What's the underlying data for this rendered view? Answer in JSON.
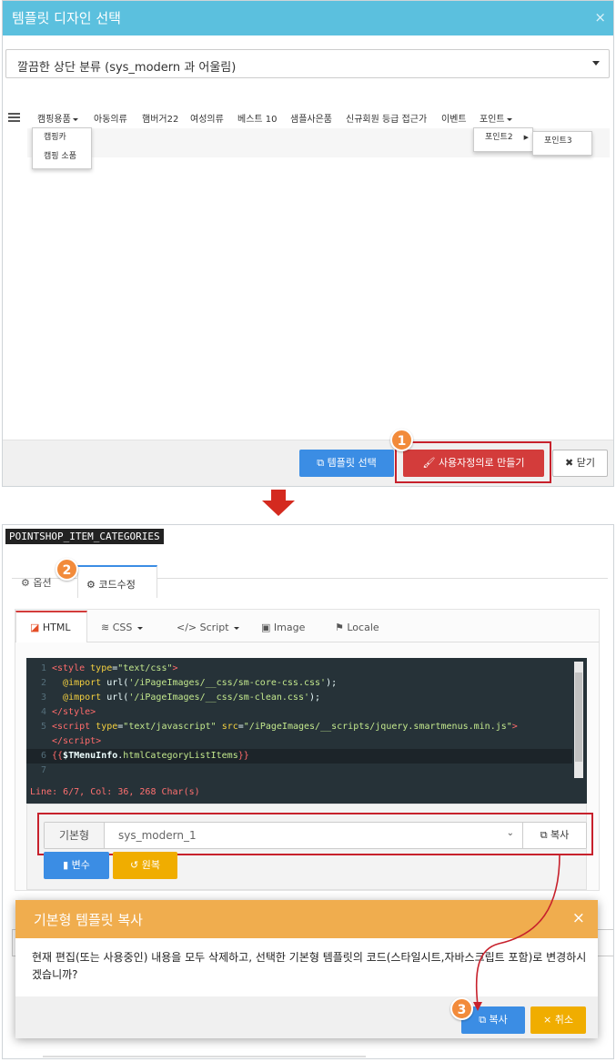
{
  "modal": {
    "title": "템플릿 디자인 선택",
    "close_icon": "×",
    "select_value": "깔끔한 상단 분류 (sys_modern 과 어울림)",
    "menu": {
      "items": [
        "캠핑용품",
        "아동의류",
        "햄버거22",
        "여성의류",
        "베스트 10",
        "샘플사은품",
        "신규회원 등급 접근가",
        "이벤트",
        "포인트"
      ],
      "submenu_camping": [
        "캠핑카",
        "캠핑 소품"
      ],
      "submenu_point": [
        "포인트2"
      ],
      "submenu_point2": [
        "포인트3"
      ]
    },
    "footer": {
      "template_select": "템플릿 선택",
      "customize": "사용자정의로 만들기",
      "close": "닫기"
    },
    "badge1": "1"
  },
  "panel": {
    "title": "POINTSHOP_ITEM_CATEGORIES",
    "tabs": {
      "options": "옵션",
      "code_edit": "코드수정"
    },
    "badge2": "2",
    "subtabs": {
      "html": "HTML",
      "css": "CSS",
      "script": "Script",
      "image": "Image",
      "locale": "Locale"
    },
    "code": {
      "line_numbers": [
        "1",
        "2",
        "3",
        "4",
        "5",
        "6",
        "7"
      ],
      "status": "Line: 6/7, Col: 36, 268 Char(s)"
    },
    "preset": {
      "label": "기본형",
      "value": "sys_modern_1",
      "copy": "복사"
    },
    "variables_btn": "변수",
    "revert_btn": "원복"
  },
  "dialog": {
    "title": "기본형 템플릿 복사",
    "close_icon": "×",
    "message": "현재 편집(또는 사용중인) 내용을 모두 삭제하고, 선택한 기본형 템플릿의 코드(스타일시트,자바스크립트 포함)로 변경하시겠습니까?",
    "copy": "복사",
    "cancel": "취소",
    "badge3": "3"
  },
  "colors": {
    "header": "#5bc0de",
    "primary": "#3b8de4",
    "danger": "#d33c3b",
    "warning": "#f0ad4e",
    "highlight": "#c7212c",
    "badge": "#f28b3b"
  }
}
